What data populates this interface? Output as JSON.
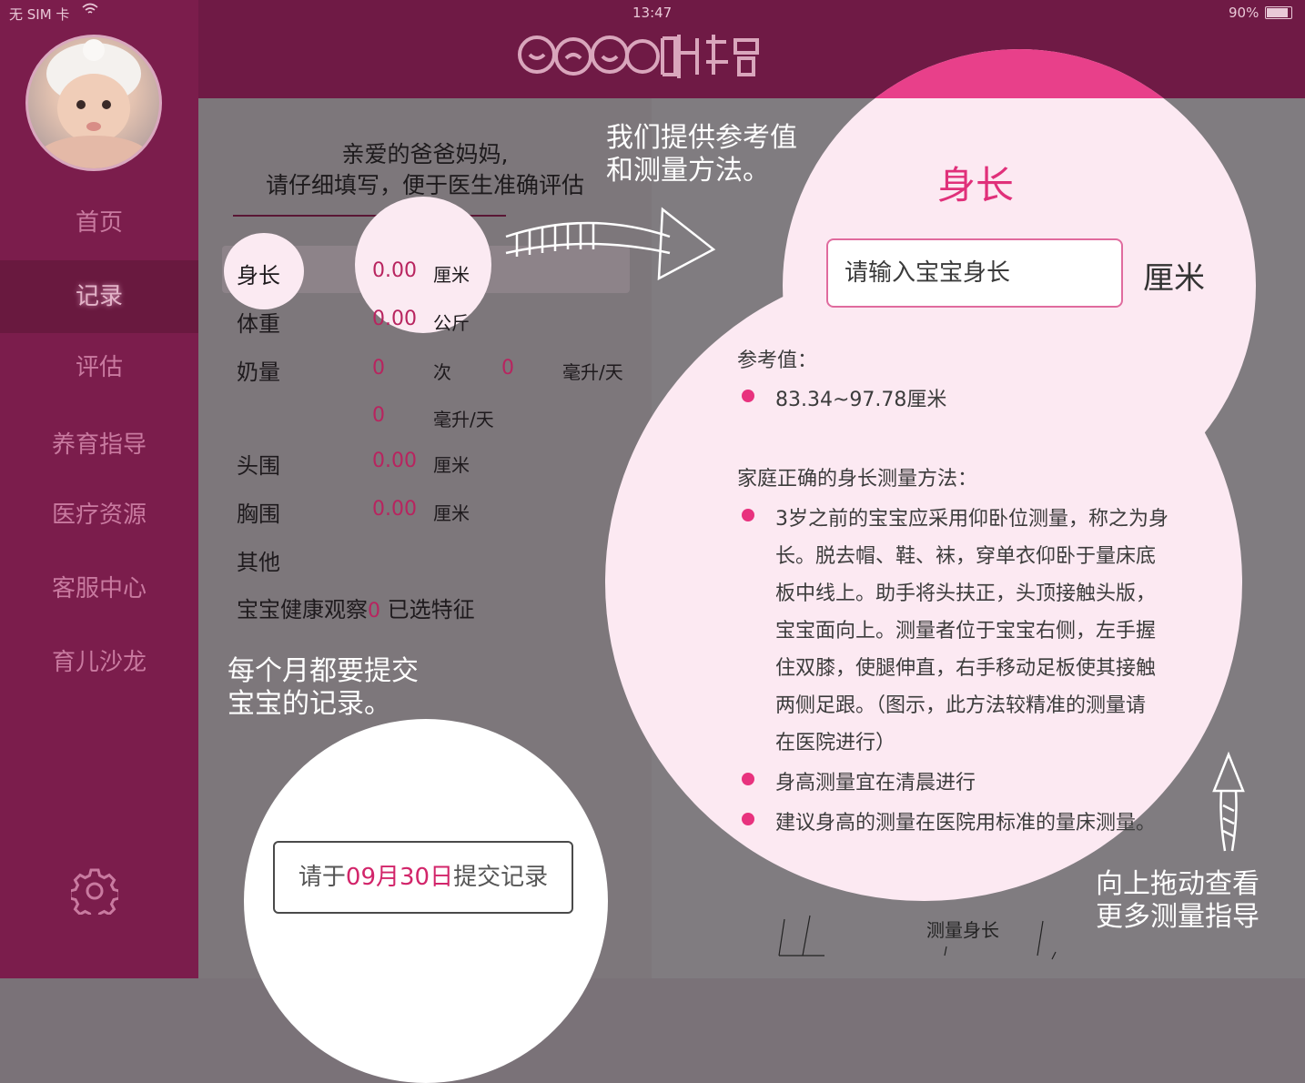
{
  "status_bar": {
    "carrier": "无 SIM 卡",
    "time": "13:47",
    "battery": "90%"
  },
  "sidebar": {
    "items": [
      {
        "label": "首页"
      },
      {
        "label": "记录"
      },
      {
        "label": "评估"
      },
      {
        "label": "养育指导"
      },
      {
        "label": "医疗资源"
      },
      {
        "label": "客服中心"
      },
      {
        "label": "育儿沙龙"
      }
    ],
    "active_index": 1
  },
  "form": {
    "title_line1": "亲爱的爸爸妈妈,",
    "title_line2": "请仔细填写，便于医生准确评估",
    "rows": {
      "height": {
        "label": "身长",
        "value": "0.00",
        "unit": "厘米"
      },
      "weight": {
        "label": "体重",
        "value": "0.00",
        "unit": "公斤"
      },
      "milk": {
        "label": "奶量",
        "count": "0",
        "count_unit": "次",
        "amount": "0",
        "amount_unit": "毫升/天",
        "amount2": "0",
        "amount2_unit": "毫升/天"
      },
      "head": {
        "label": "头围",
        "value": "0.00",
        "unit": "厘米"
      },
      "chest": {
        "label": "胸围",
        "value": "0.00",
        "unit": "厘米"
      },
      "other": {
        "label": "其他"
      },
      "health": {
        "label": "宝宝健康观察",
        "count": "0",
        "suffix": "已选特征"
      }
    },
    "submit": {
      "prefix": "请于",
      "date": "09月30日",
      "suffix": "提交记录"
    }
  },
  "info": {
    "title": "身长",
    "input_placeholder": "请输入宝宝身长",
    "unit": "厘米",
    "reference_label": "参考值：",
    "reference_value": "83.34~97.78厘米",
    "method_title": "家庭正确的身长测量方法：",
    "method_lines": [
      "3岁之前的宝宝应采用仰卧位测量，称之为身",
      "长。脱去帽、鞋、袜，穿单衣仰卧于量床底",
      "板中线上。助手将头扶正，头顶接触头版，",
      "宝宝面向上。测量者位于宝宝右侧，左手握",
      "住双膝，使腿伸直，右手移动足板使其接触",
      "两侧足跟。（图示，此方法较精准的测量请",
      "在医院进行）"
    ],
    "tip1": "身高测量宜在清晨进行",
    "tip2": "建议身高的测量在医院用标准的量床测量。",
    "figure_caption": "测量身长"
  },
  "annotations": {
    "reference_line1": "我们提供参考值",
    "reference_line2": "和测量方法。",
    "monthly_line1": "每个月都要提交",
    "monthly_line2": "宝宝的记录。",
    "drag_line1": "向上拖动查看",
    "drag_line2": "更多测量指导"
  },
  "colors": {
    "sidebar": "#7b1d4c",
    "header": "#6f1a45",
    "accent": "#e0307a",
    "value_red": "#b8245f"
  }
}
